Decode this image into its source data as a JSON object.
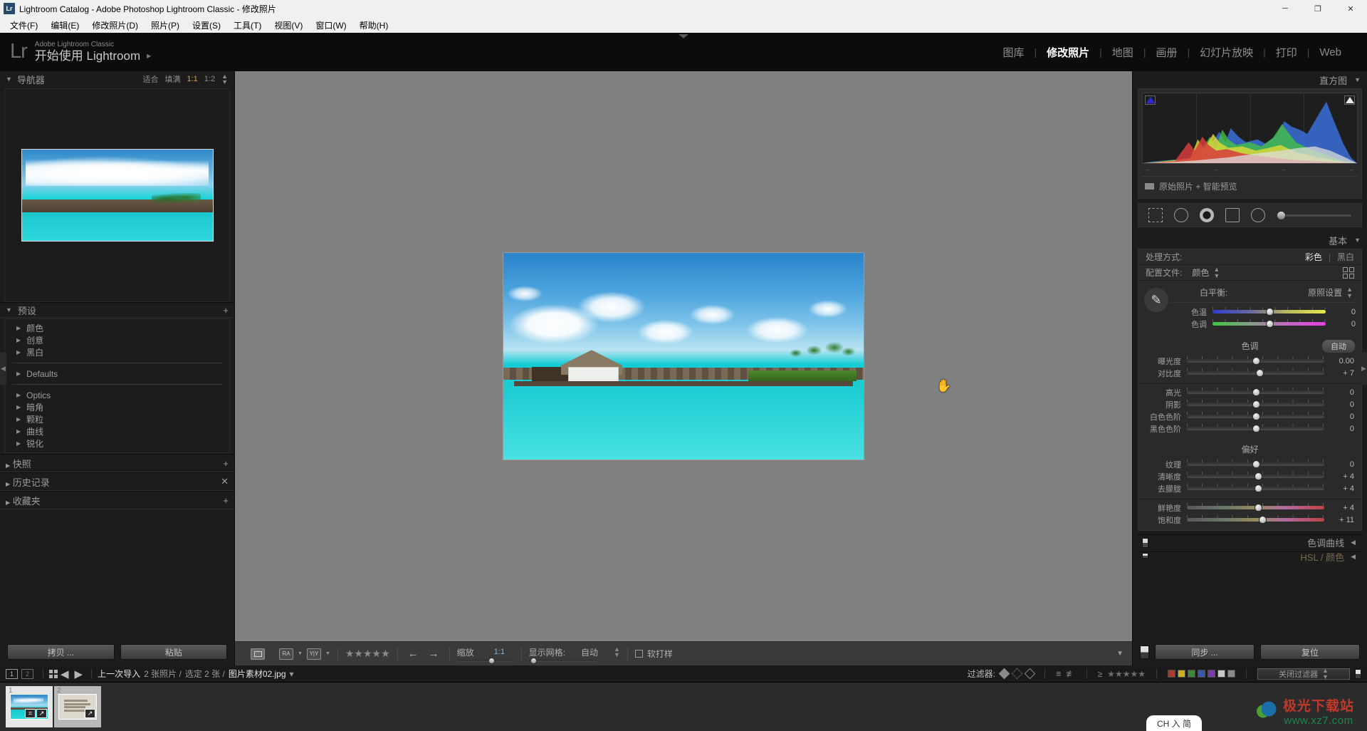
{
  "window": {
    "title": "Lightroom Catalog - Adobe Photoshop Lightroom Classic - 修改照片",
    "app_badge": "Lr",
    "minimize": "─",
    "maximize": "❐",
    "close": "✕"
  },
  "menu": [
    "文件(F)",
    "编辑(E)",
    "修改照片(D)",
    "照片(P)",
    "设置(S)",
    "工具(T)",
    "视图(V)",
    "窗口(W)",
    "帮助(H)"
  ],
  "identity": {
    "logo": "Lr",
    "line1": "Adobe Lightroom Classic",
    "line2": "开始使用 Lightroom",
    "arrow": "▶"
  },
  "modules": [
    {
      "label": "图库",
      "active": false
    },
    {
      "label": "修改照片",
      "active": true
    },
    {
      "label": "地图",
      "active": false
    },
    {
      "label": "画册",
      "active": false
    },
    {
      "label": "幻灯片放映",
      "active": false
    },
    {
      "label": "打印",
      "active": false
    },
    {
      "label": "Web",
      "active": false
    }
  ],
  "navigator": {
    "title": "导航器",
    "modes": [
      "适合",
      "填满",
      "1:1",
      "1:2"
    ],
    "active_mode": "1:1"
  },
  "presets": {
    "title": "预设",
    "add_icon": "+",
    "groups_1": [
      "颜色",
      "创意",
      "黑白"
    ],
    "groups_2": [
      "Defaults"
    ],
    "groups_3": [
      "Optics",
      "暗角",
      "颗粒",
      "曲线",
      "锐化"
    ]
  },
  "left_sections": [
    {
      "title": "快照",
      "icon": "+"
    },
    {
      "title": "历史记录",
      "icon": "✕"
    },
    {
      "title": "收藏夹",
      "icon": "+"
    }
  ],
  "left_footer": {
    "copy": "拷贝 ...",
    "paste": "粘贴"
  },
  "toolbar": {
    "zoom_label": "缩放",
    "zoom_value": "1:1",
    "grid_label": "显示网格:",
    "grid_value": "自动",
    "softproof_label": "软打样",
    "compare_ra": "RA",
    "compare_yy": "Y|Y",
    "prev_arrow": "←",
    "next_arrow": "→",
    "stars": "★★★★★",
    "right_caret": "▼"
  },
  "histogram": {
    "title": "直方图",
    "collapse": "▼",
    "footer_label": "原始照片 + 智能预览",
    "ticks": [
      "–",
      "–",
      "–",
      "–"
    ]
  },
  "basic": {
    "title": "基本",
    "collapse": "▼",
    "treatment_label": "处理方式:",
    "treatment_color": "彩色",
    "treatment_bw": "黑白",
    "profile_label": "配置文件:",
    "profile_value": "颜色",
    "wb_label": "白平衡:",
    "wb_value": "原照设置",
    "tone_title": "色调",
    "auto_label": "自动",
    "presence_title": "偏好",
    "sliders_wb": [
      {
        "label": "色温",
        "value": "0",
        "pos": 50,
        "kind": "temp"
      },
      {
        "label": "色调",
        "value": "0",
        "pos": 50,
        "kind": "tint"
      }
    ],
    "sliders_tone": [
      {
        "label": "曝光度",
        "value": "0.00",
        "pos": 50,
        "kind": "plain"
      },
      {
        "label": "对比度",
        "value": "+ 7",
        "pos": 53,
        "kind": "plain"
      }
    ],
    "sliders_tone2": [
      {
        "label": "高光",
        "value": "0",
        "pos": 50,
        "kind": "plain"
      },
      {
        "label": "阴影",
        "value": "0",
        "pos": 50,
        "kind": "plain"
      },
      {
        "label": "白色色阶",
        "value": "0",
        "pos": 50,
        "kind": "plain"
      },
      {
        "label": "黑色色阶",
        "value": "0",
        "pos": 50,
        "kind": "plain"
      }
    ],
    "sliders_presence": [
      {
        "label": "纹理",
        "value": "0",
        "pos": 50,
        "kind": "plain"
      },
      {
        "label": "清晰度",
        "value": "+ 4",
        "pos": 52,
        "kind": "plain"
      },
      {
        "label": "去朦胧",
        "value": "+ 4",
        "pos": 52,
        "kind": "plain"
      }
    ],
    "sliders_vibrance": [
      {
        "label": "鲜艳度",
        "value": "+ 4",
        "pos": 52,
        "kind": "vib"
      },
      {
        "label": "饱和度",
        "value": "+ 11",
        "pos": 55,
        "kind": "sat"
      }
    ]
  },
  "right_panels": [
    {
      "title": "色调曲线",
      "collapse": "◀"
    },
    {
      "title": "HSL / 颜色",
      "collapse": "◀"
    }
  ],
  "right_footer": {
    "sync": "同步 ...",
    "reset": "复位"
  },
  "filmstrip": {
    "screen1": "1",
    "screen2": "2",
    "prev": "◀",
    "next": "▶",
    "source": "上一次导入",
    "count": "2 张照片 /",
    "selected": "选定 2 张 /",
    "filename": "图片素材02.jpg",
    "file_caret": "▾",
    "filter_label": "过滤器:",
    "filter_stars_prefix": "≥",
    "filter_stars": "★★★★★",
    "filter_select": "关闭过滤器",
    "swatch_colors": [
      "#b03a2e",
      "#c8b020",
      "#3a8a3a",
      "#3a5ab0",
      "#7a3ab0",
      "#c8c8c8",
      "#8a8a8a"
    ],
    "thumbs": [
      {
        "num": "1",
        "selected": true,
        "type": "photo",
        "badges": [
          "⌗",
          "↗"
        ]
      },
      {
        "num": "2",
        "selected": false,
        "type": "doc",
        "badges": [
          "↗"
        ]
      }
    ]
  },
  "watermark": {
    "title": "极光下载站",
    "url": "www.xz7.com"
  },
  "ime": {
    "label": "CH 入 简"
  },
  "colors": {
    "accent_orange": "#d9a441",
    "panel_bg": "#1c1c1c",
    "stage_bg": "#808080",
    "title_bar": "#f0f0f0"
  }
}
